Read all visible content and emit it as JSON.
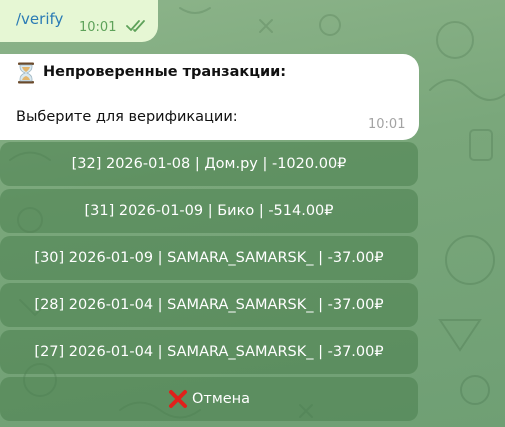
{
  "outgoing": {
    "text": "/verify",
    "time": "10:01",
    "check_color": "#5ea25a"
  },
  "incoming": {
    "icon": "hourglass-icon",
    "title": "Непроверенные транзакции:",
    "body": "Выберите для верификации:",
    "time": "10:01"
  },
  "keyboard": {
    "buttons": [
      {
        "label": "[32] 2026-01-08 | Дом.ру | -1020.00₽"
      },
      {
        "label": "[31] 2026-01-09 | Бико | -514.00₽"
      },
      {
        "label": "[30] 2026-01-09 | SAMARA_SAMARSK_ | -37.00₽"
      },
      {
        "label": "[28] 2026-01-04 | SAMARA_SAMARSK_ | -37.00₽"
      },
      {
        "label": "[27] 2026-01-04 | SAMARA_SAMARSK_ | -37.00₽"
      }
    ],
    "cancel": {
      "icon": "cross-mark-icon",
      "label": "Отмена",
      "icon_color": "#e0201b"
    }
  },
  "colors": {
    "outgoing_bubble": "#e6f7d4",
    "incoming_bubble": "#ffffff",
    "keyboard_button": "#5b8f5f"
  }
}
